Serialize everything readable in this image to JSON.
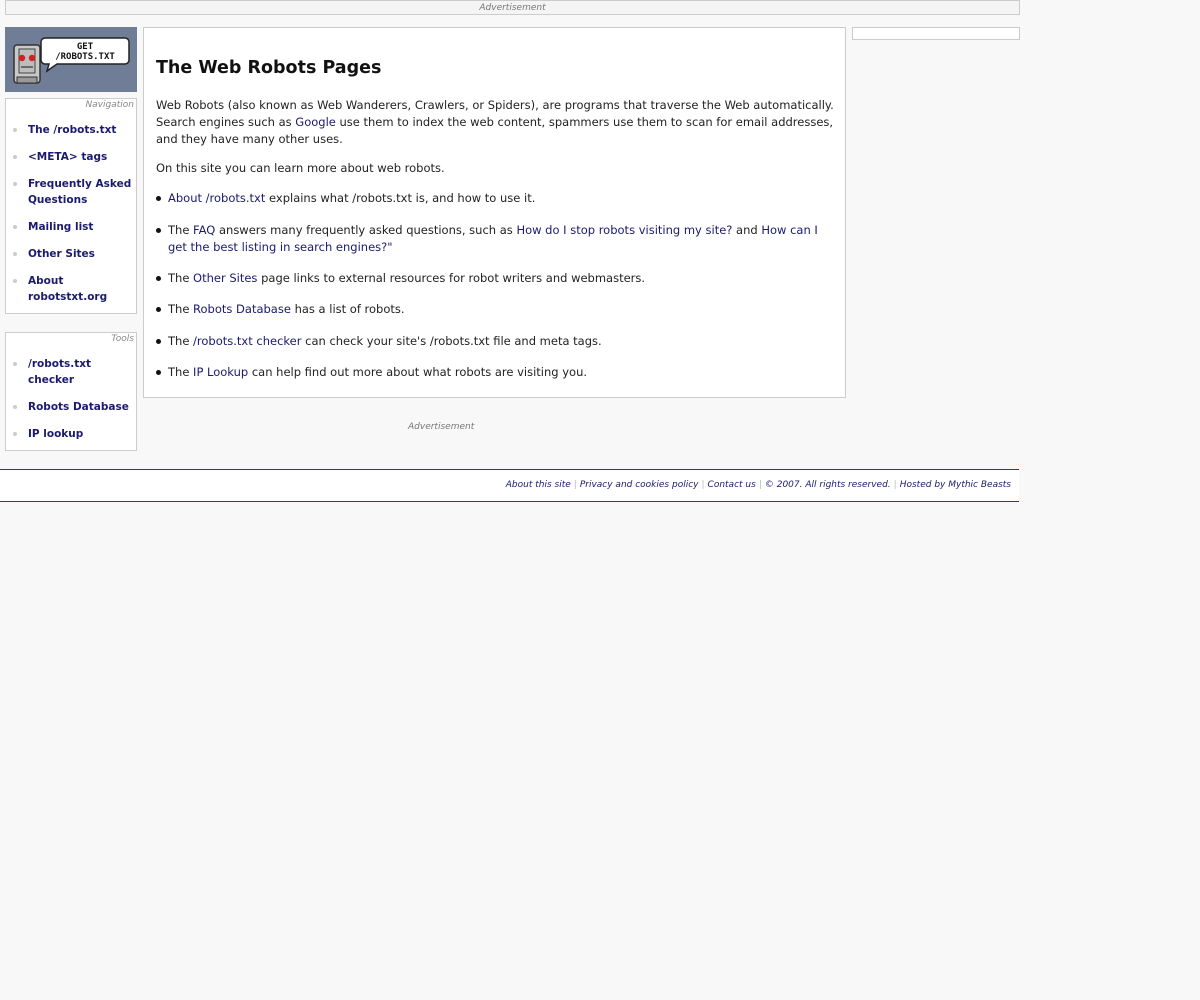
{
  "top_ad": {
    "label": "Advertisement"
  },
  "logo": {
    "line1": "GET",
    "line2": "/ROBOTS.TXT"
  },
  "navigation": {
    "title": "Navigation",
    "items": [
      {
        "label": "The /robots.txt"
      },
      {
        "label": "<META> tags"
      },
      {
        "label": "Frequently Asked Questions"
      },
      {
        "label": "Mailing list"
      },
      {
        "label": "Other Sites"
      },
      {
        "label": "About robotstxt.org"
      }
    ]
  },
  "tools": {
    "title": "Tools",
    "items": [
      {
        "label": "/robots.txt checker"
      },
      {
        "label": "Robots Database"
      },
      {
        "label": "IP lookup"
      }
    ]
  },
  "main": {
    "title": "The Web Robots Pages",
    "intro": {
      "before": "Web Robots (also known as Web Wanderers, Crawlers, or Spiders), are programs that traverse the Web automatically. Search engines such as ",
      "link": "Google",
      "after": " use them to index the web content, spammers use them to scan for email addresses, and they have many other uses."
    },
    "learn_more": "On this site you can learn more about web robots.",
    "bullets": {
      "about": {
        "link": "About /robots.txt",
        "text": " explains what /robots.txt is, and how to use it."
      },
      "faq": {
        "prefix": "The ",
        "link": "FAQ",
        "text": " answers many frequently asked questions, such as ",
        "q1": "How do I stop robots visiting my site?",
        "and": " and ",
        "q2": "How can I get the best listing in search engines?\""
      },
      "other": {
        "prefix": "The ",
        "link": "Other Sites",
        "text": " page links to external resources for robot writers and webmasters."
      },
      "db": {
        "prefix": "The ",
        "link": "Robots Database",
        "text": " has a list of robots."
      },
      "checker": {
        "prefix": "The ",
        "link": "/robots.txt checker",
        "text": " can check your site's /robots.txt file and meta tags."
      },
      "ip": {
        "prefix": "The ",
        "link": "IP Lookup",
        "text": " can help find out more about what robots are visiting you."
      }
    }
  },
  "bottom_ad": {
    "label": "Advertisement"
  },
  "footer": {
    "about": "About this site",
    "privacy": "Privacy and cookies policy",
    "contact": "Contact us",
    "copyright": "© 2007. All rights reserved.",
    "hosted": "Hosted by Mythic Beasts"
  }
}
